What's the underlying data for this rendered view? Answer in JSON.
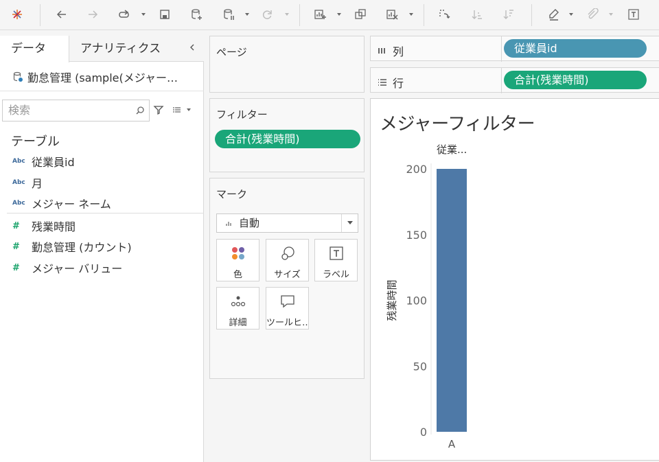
{
  "toolbar": {
    "icons": [
      "tableau-logo-icon",
      "undo-icon",
      "redo-icon",
      "replay-icon",
      "save-icon",
      "new-datasource-icon",
      "pause-autoupdate-icon",
      "refresh-icon",
      "new-worksheet-icon",
      "duplicate-icon",
      "clear-icon",
      "swap-icon",
      "sort-ascending-icon",
      "sort-descending-icon",
      "highlight-icon",
      "group-icon",
      "show-labels-icon"
    ]
  },
  "data_pane": {
    "tabs": [
      "データ",
      "アナリティクス"
    ],
    "datasource": "勤怠管理 (sample(メジャー…",
    "search_placeholder": "検索",
    "section_title": "テーブル",
    "dimensions": [
      {
        "type": "Abc",
        "name": "従業員id"
      },
      {
        "type": "Abc",
        "name": "月"
      },
      {
        "type": "Abc",
        "name": "メジャー ネーム"
      }
    ],
    "measures": [
      {
        "type": "#",
        "name": "残業時間"
      },
      {
        "type": "#",
        "name": "勤怠管理 (カウント)"
      },
      {
        "type": "#",
        "name": "メジャー バリュー"
      }
    ]
  },
  "pages_card": {
    "title": "ページ"
  },
  "filters_card": {
    "title": "フィルター",
    "pill": "合計(残業時間)"
  },
  "marks_card": {
    "title": "マーク",
    "mark_type": "自動",
    "buttons": [
      "色",
      "サイズ",
      "ラベル",
      "詳細",
      "ツールヒ…"
    ]
  },
  "columns_shelf": {
    "label": "列",
    "pill": "従業員id"
  },
  "rows_shelf": {
    "label": "行",
    "pill": "合計(残業時間)"
  },
  "view": {
    "title": "メジャーフィルター",
    "column_header": "従業..."
  },
  "chart_data": {
    "type": "bar",
    "categories": [
      "A"
    ],
    "values": [
      200
    ],
    "title": "メジャーフィルター",
    "xlabel": "",
    "ylabel": "残業時間",
    "ylim": [
      0,
      200
    ],
    "yticks": [
      0,
      50,
      100,
      150,
      200
    ],
    "grid": false,
    "bar_color": "#4e79a7"
  },
  "colors": {
    "dimension_pill": "#4996b2",
    "measure_pill": "#1aa679"
  }
}
